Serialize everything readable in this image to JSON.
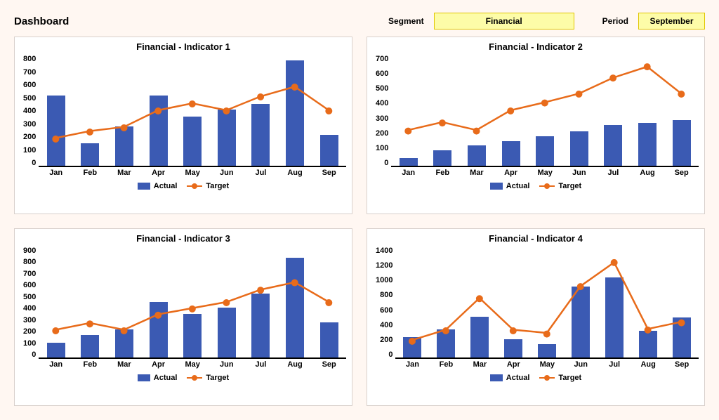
{
  "header": {
    "title": "Dashboard",
    "segment_label": "Segment",
    "segment_value": "Financial",
    "period_label": "Period",
    "period_value": "September"
  },
  "legend": {
    "actual": "Actual",
    "target": "Target"
  },
  "colors": {
    "bar": "#3b5ab3",
    "line": "#e86b1a"
  },
  "chart_data": [
    {
      "type": "bar",
      "title": "Financial - Indicator 1",
      "categories": [
        "Jan",
        "Feb",
        "Mar",
        "Apr",
        "May",
        "Jun",
        "Jul",
        "Aug",
        "Sep"
      ],
      "series": [
        {
          "name": "Actual",
          "kind": "bar",
          "values": [
            500,
            160,
            280,
            500,
            350,
            400,
            440,
            750,
            220
          ]
        },
        {
          "name": "Target",
          "kind": "line",
          "values": [
            200,
            250,
            280,
            400,
            450,
            400,
            500,
            570,
            400
          ]
        }
      ],
      "ymax": 800,
      "ystep": 100
    },
    {
      "type": "bar",
      "title": "Financial - Indicator 2",
      "categories": [
        "Jan",
        "Feb",
        "Mar",
        "Apr",
        "May",
        "Jun",
        "Jul",
        "Aug",
        "Sep"
      ],
      "series": [
        {
          "name": "Actual",
          "kind": "bar",
          "values": [
            50,
            95,
            125,
            155,
            185,
            215,
            255,
            265,
            285
          ]
        },
        {
          "name": "Target",
          "kind": "line",
          "values": [
            225,
            275,
            225,
            350,
            400,
            455,
            555,
            625,
            455
          ]
        }
      ],
      "ymax": 700,
      "ystep": 100
    },
    {
      "type": "bar",
      "title": "Financial - Indicator 3",
      "categories": [
        "Jan",
        "Feb",
        "Mar",
        "Apr",
        "May",
        "Jun",
        "Jul",
        "Aug",
        "Sep"
      ],
      "series": [
        {
          "name": "Actual",
          "kind": "bar",
          "values": [
            120,
            180,
            225,
            445,
            350,
            400,
            510,
            800,
            280
          ]
        },
        {
          "name": "Target",
          "kind": "line",
          "values": [
            225,
            280,
            225,
            350,
            400,
            450,
            550,
            610,
            450
          ]
        }
      ],
      "ymax": 900,
      "ystep": 100
    },
    {
      "type": "bar",
      "title": "Financial - Indicator 4",
      "categories": [
        "Jan",
        "Feb",
        "Mar",
        "Apr",
        "May",
        "Jun",
        "Jul",
        "Aug",
        "Sep"
      ],
      "series": [
        {
          "name": "Actual",
          "kind": "bar",
          "values": [
            250,
            350,
            510,
            230,
            170,
            880,
            1000,
            330,
            500
          ]
        },
        {
          "name": "Target",
          "kind": "line",
          "values": [
            220,
            350,
            750,
            350,
            310,
            900,
            1200,
            360,
            450
          ]
        }
      ],
      "ymax": 1400,
      "ystep": 200
    }
  ]
}
